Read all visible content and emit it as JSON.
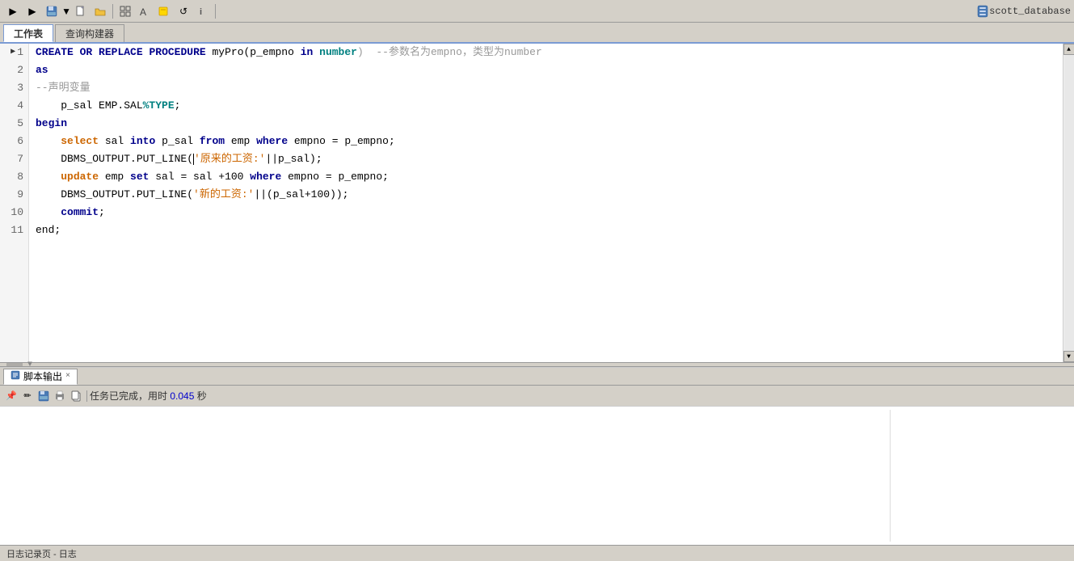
{
  "toolbar": {
    "buttons": [
      {
        "name": "run",
        "icon": "▶",
        "label": "Run"
      },
      {
        "name": "run2",
        "icon": "▶",
        "label": "Run2"
      },
      {
        "name": "save",
        "icon": "💾",
        "label": "Save"
      },
      {
        "name": "save-dropdown",
        "icon": "▼",
        "label": "SaveDropdown"
      },
      {
        "name": "new",
        "icon": "📄",
        "label": "New"
      },
      {
        "name": "open",
        "icon": "📂",
        "label": "Open"
      },
      {
        "name": "sep1",
        "icon": "|",
        "label": "sep"
      },
      {
        "name": "grid",
        "icon": "⊞",
        "label": "Grid"
      },
      {
        "name": "find",
        "icon": "🔍",
        "label": "Find"
      },
      {
        "name": "highlight",
        "icon": "✏",
        "label": "Highlight"
      },
      {
        "name": "refresh",
        "icon": "↺",
        "label": "Refresh"
      },
      {
        "name": "info",
        "icon": "ℹ",
        "label": "Info"
      }
    ],
    "db_icon": "🗄",
    "db_name": "scott_database"
  },
  "tabs": [
    {
      "label": "工作表",
      "active": true
    },
    {
      "label": "查询构建器",
      "active": false
    }
  ],
  "editor": {
    "lines": [
      {
        "num": 1,
        "has_arrow": true,
        "tokens": [
          {
            "text": "CREATE",
            "class": "kw-blue"
          },
          {
            "text": " ",
            "class": "normal"
          },
          {
            "text": "OR",
            "class": "kw-blue"
          },
          {
            "text": " ",
            "class": "normal"
          },
          {
            "text": "REPLACE",
            "class": "kw-blue"
          },
          {
            "text": " ",
            "class": "normal"
          },
          {
            "text": "PROCEDURE",
            "class": "kw-blue"
          },
          {
            "text": " myPro(p_empno ",
            "class": "normal"
          },
          {
            "text": "in",
            "class": "kw-blue"
          },
          {
            "text": " ",
            "class": "normal"
          },
          {
            "text": "number",
            "class": "kw-teal"
          },
          {
            "text": ")  --参数名为empno，类型为number",
            "class": "comment"
          }
        ]
      },
      {
        "num": 2,
        "tokens": [
          {
            "text": "as",
            "class": "kw-blue"
          }
        ]
      },
      {
        "num": 3,
        "tokens": [
          {
            "text": "--声明变量",
            "class": "comment"
          }
        ]
      },
      {
        "num": 4,
        "tokens": [
          {
            "text": "    p_sal EMP.SAL",
            "class": "normal"
          },
          {
            "text": "%TYPE",
            "class": "kw-teal"
          },
          {
            "text": ";",
            "class": "normal"
          }
        ]
      },
      {
        "num": 5,
        "tokens": [
          {
            "text": "begin",
            "class": "kw-blue"
          }
        ]
      },
      {
        "num": 6,
        "tokens": [
          {
            "text": "    ",
            "class": "normal"
          },
          {
            "text": "select",
            "class": "kw-orange"
          },
          {
            "text": " sal ",
            "class": "normal"
          },
          {
            "text": "into",
            "class": "kw-blue"
          },
          {
            "text": " p_sal ",
            "class": "normal"
          },
          {
            "text": "from",
            "class": "kw-blue"
          },
          {
            "text": " emp ",
            "class": "normal"
          },
          {
            "text": "where",
            "class": "kw-blue"
          },
          {
            "text": " empno = p_empno;",
            "class": "normal"
          }
        ]
      },
      {
        "num": 7,
        "has_cursor": true,
        "tokens": [
          {
            "text": "    DBMS_OUTPUT.PUT_LINE(",
            "class": "normal"
          },
          {
            "text": "'原来的工资:'",
            "class": "str-orange"
          },
          {
            "text": "||p_sal);",
            "class": "normal"
          }
        ]
      },
      {
        "num": 8,
        "tokens": [
          {
            "text": "    ",
            "class": "normal"
          },
          {
            "text": "update",
            "class": "kw-orange"
          },
          {
            "text": " emp ",
            "class": "normal"
          },
          {
            "text": "set",
            "class": "kw-blue"
          },
          {
            "text": " sal = sal +100 ",
            "class": "normal"
          },
          {
            "text": "where",
            "class": "kw-blue"
          },
          {
            "text": " empno = p_empno;",
            "class": "normal"
          }
        ]
      },
      {
        "num": 9,
        "tokens": [
          {
            "text": "    DBMS_OUTPUT.PUT_LINE(",
            "class": "normal"
          },
          {
            "text": "'新的工资:'",
            "class": "str-orange"
          },
          {
            "text": "||(p_sal+100));",
            "class": "normal"
          }
        ]
      },
      {
        "num": 10,
        "tokens": [
          {
            "text": "    ",
            "class": "normal"
          },
          {
            "text": "commit",
            "class": "kw-blue"
          },
          {
            "text": ";",
            "class": "normal"
          }
        ]
      },
      {
        "num": 11,
        "tokens": [
          {
            "text": "end;",
            "class": "normal"
          }
        ]
      }
    ]
  },
  "output_panel": {
    "tab_label": "脚本输出",
    "tab_close": "×",
    "toolbar_buttons": [
      "📌",
      "✏",
      "💾",
      "🖨",
      "📋"
    ],
    "status_label": "任务已完成，用时 ",
    "status_time": "0.045",
    "status_unit": " 秒"
  },
  "status_bar": {
    "label": "日志记录页 - 日志"
  }
}
